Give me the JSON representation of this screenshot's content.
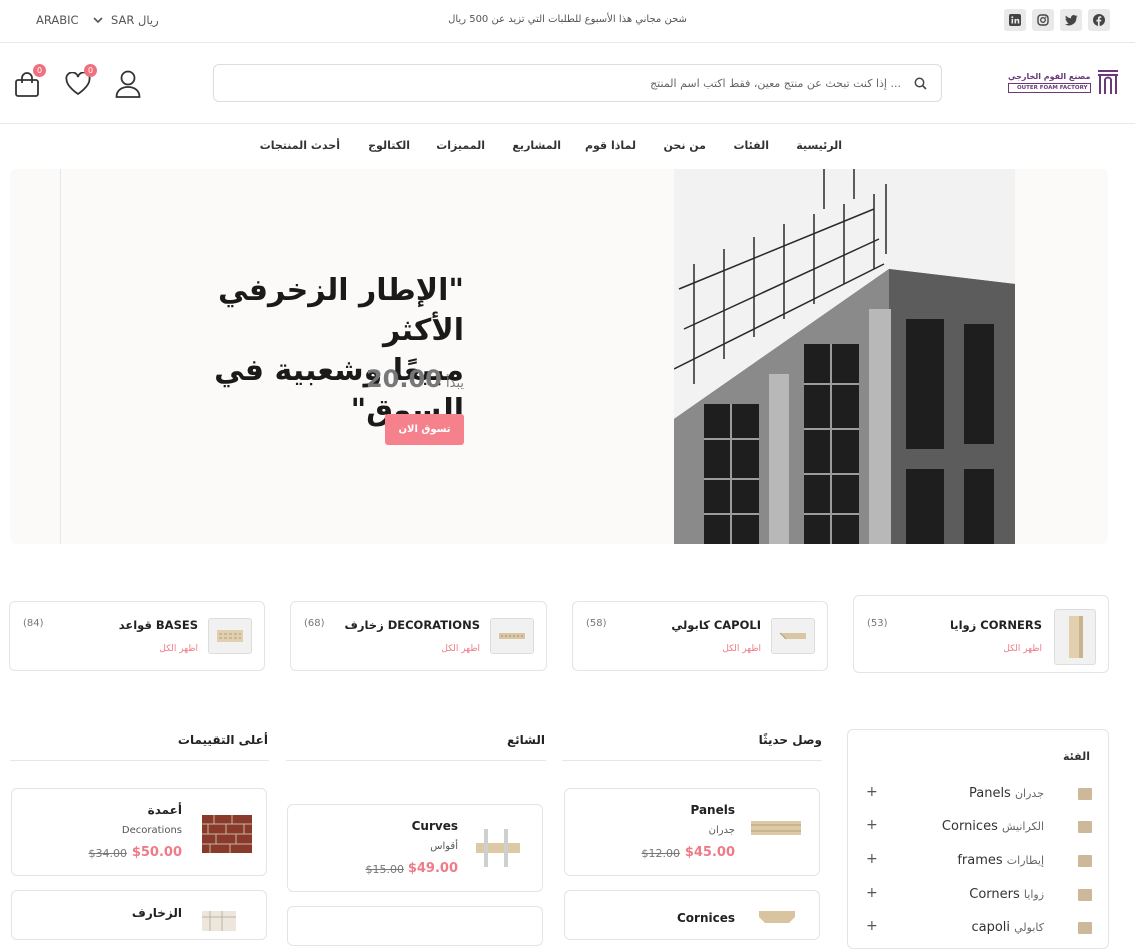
{
  "topbar": {
    "shipping_msg": "شحن مجاني هذا الأسبوع للطلبات التي تزيد عن 500 ريال",
    "currency": "SAR ريال",
    "language": "ARABIC",
    "social": [
      "facebook-icon",
      "twitter-icon",
      "instagram-icon",
      "linkedin-icon"
    ]
  },
  "header": {
    "logo_ar": "مصنع الفوم الخارجي",
    "logo_en": "OUTER FOAM FACTORY",
    "search_placeholder": "إذا كنت تبحث عن منتج معين، فقط اكتب اسم المنتج ...",
    "wishlist_count": "0",
    "cart_count": "0"
  },
  "nav": [
    "الرئيسية",
    "الفئات",
    "من نحن",
    "لماذا قوم",
    "المشاريع",
    "المميزات",
    "الكتالوج",
    "أحدث المنتجات"
  ],
  "hero": {
    "title_line1": "\"الإطار الزخرفي الأكثر",
    "title_line2": "مبيعًا وشعبية في السوق\"",
    "price_prefix": "يبدأ",
    "price": "20.00",
    "button": "تسوق الان"
  },
  "categories": [
    {
      "name": "زوايا CORNERS",
      "link": "اظهر الكل",
      "count": "(53)"
    },
    {
      "name": "كابولي CAPOLI",
      "link": "اظهر الكل",
      "count": "(58)"
    },
    {
      "name": "زخارف DECORATIONS",
      "link": "اظهر الكل",
      "count": "(68)"
    },
    {
      "name": "قواعد BASES",
      "link": "اظهر الكل",
      "count": "(84)"
    }
  ],
  "sections": {
    "new": "وصل حديثًا",
    "popular": "الشائع",
    "top_rated": "أعلى التقييمات"
  },
  "products_new": [
    {
      "title": "Panels",
      "sub": "جدران",
      "old": "$12.00",
      "price": "$45.00"
    },
    {
      "title": "Cornices",
      "sub": "",
      "old": "",
      "price": ""
    }
  ],
  "products_popular": [
    {
      "title": "Curves",
      "sub": "أقواس",
      "old": "$15.00",
      "price": "$49.00"
    }
  ],
  "products_top": [
    {
      "title": "أعمدة",
      "sub": "Decorations",
      "old": "$34.00",
      "price": "$50.00"
    },
    {
      "title": "الزخارف",
      "sub": "",
      "old": "",
      "price": ""
    }
  ],
  "filter": {
    "title": "الفئة",
    "items": [
      {
        "en": "Panels",
        "ar": "جدران"
      },
      {
        "en": "Cornices",
        "ar": "الكرانيش"
      },
      {
        "en": "frames",
        "ar": "إيطارات"
      },
      {
        "en": "Corners",
        "ar": "زوايا"
      },
      {
        "en": "capoli",
        "ar": "كابولي"
      }
    ]
  },
  "colors": {
    "accent": "#f07a87",
    "button": "#f5818d",
    "brand": "#6a3a78"
  }
}
